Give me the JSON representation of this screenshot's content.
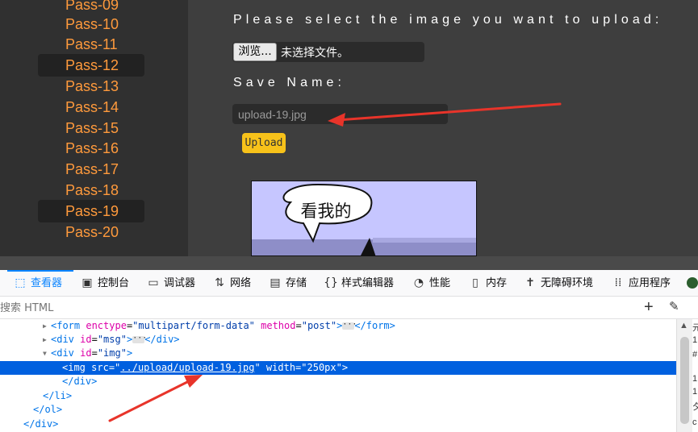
{
  "sidebar": {
    "items": [
      {
        "label": "Pass-09"
      },
      {
        "label": "Pass-10"
      },
      {
        "label": "Pass-11"
      },
      {
        "label": "Pass-12",
        "active": true
      },
      {
        "label": "Pass-13"
      },
      {
        "label": "Pass-14"
      },
      {
        "label": "Pass-15"
      },
      {
        "label": "Pass-16"
      },
      {
        "label": "Pass-17"
      },
      {
        "label": "Pass-18"
      },
      {
        "label": "Pass-19",
        "active": true
      },
      {
        "label": "Pass-20"
      }
    ]
  },
  "upload": {
    "select_prompt": "Please select the image you want to upload:",
    "browse_label": "浏览...",
    "file_status": "未选择文件。",
    "save_label": "Save Name:",
    "save_value": "upload-19.jpg",
    "upload_label": "Upload",
    "preview_speech": "看我的"
  },
  "devtools": {
    "tabs": [
      {
        "icon": "inspector-icon",
        "label": "查看器",
        "active": true
      },
      {
        "icon": "console-icon",
        "label": "控制台"
      },
      {
        "icon": "debugger-icon",
        "label": "调试器"
      },
      {
        "icon": "network-icon",
        "label": "网络"
      },
      {
        "icon": "storage-icon",
        "label": "存储"
      },
      {
        "icon": "style-editor-icon",
        "label": "样式编辑器"
      },
      {
        "icon": "performance-icon",
        "label": "性能"
      },
      {
        "icon": "memory-icon",
        "label": "内存"
      },
      {
        "icon": "accessibility-icon",
        "label": "无障碍环境"
      },
      {
        "icon": "application-icon",
        "label": "应用程序"
      }
    ],
    "search_placeholder": "搜索 HTML",
    "tree": {
      "form": {
        "tag_open": "<form",
        "enctype_name": "enctype",
        "enctype_value": "\"multipart/form-data\"",
        "method_name": "method",
        "method_value": "\"post\"",
        "close": "</form>"
      },
      "msg": {
        "tag_open": "<div",
        "id_name": "id",
        "id_value": "\"msg\"",
        "close": "</div>"
      },
      "img_div": {
        "tag_open": "<div",
        "id_name": "id",
        "id_value": "\"img\""
      },
      "img": {
        "tag_open": "<img",
        "src_name": "src",
        "src_prefix": "=\"",
        "src_value": "../upload/upload-19.jpg",
        "src_suffix": "\"",
        "width_name": "width",
        "width_value": "\"250px\"",
        "end": ">"
      },
      "div_close": "</div>",
      "li_close": "</li>",
      "ol_close": "</ol>",
      "div_close2": "</div>"
    },
    "right_panel_chars": [
      "元",
      "1",
      "#",
      "1",
      "1",
      "夕",
      "c"
    ]
  },
  "colors": {
    "accent": "#0a84ff",
    "sidebar_text": "#ff9a3c",
    "upload_button": "#f7c21a",
    "annotation_arrow": "#e8342a"
  }
}
